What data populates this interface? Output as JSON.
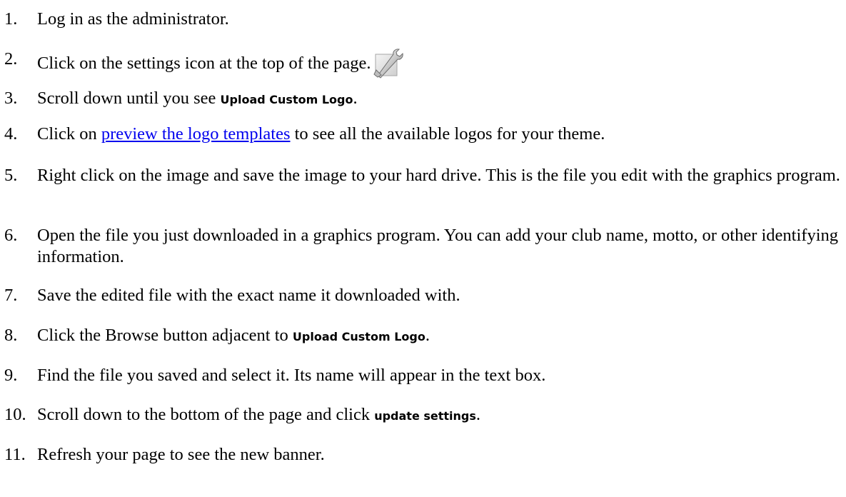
{
  "steps": [
    {
      "num": "1.",
      "text": "Log in as the administrator."
    },
    {
      "num": "2.",
      "text": "Click on the settings icon at the top of the page.",
      "icon": "wrench-settings-icon"
    },
    {
      "num": "3.",
      "pre": "Scroll down until you see ",
      "ui": "Upload Custom Logo",
      "post": "."
    },
    {
      "num": "4.",
      "pre": "Click on ",
      "link": "preview the logo templates",
      "post": " to see all the available logos for your theme."
    },
    {
      "num": "5.",
      "text": "Right click on the image and save the image to your hard drive. This is the file you edit with the graphics program."
    },
    {
      "num": "6.",
      "text": "Open the file you just downloaded in a graphics program. You can add your club name, motto, or other identifying information."
    },
    {
      "num": "7.",
      "text": "Save the edited file with the exact name it downloaded with."
    },
    {
      "num": "8.",
      "pre": "Click the Browse button adjacent to ",
      "ui": "Upload Custom Logo",
      "post": "."
    },
    {
      "num": "9.",
      "text": "Find the file you saved and select it. Its name will appear in the text box."
    },
    {
      "num": "10.",
      "pre": "Scroll down to the bottom of the page and click ",
      "ui": "update settings",
      "post": "."
    },
    {
      "num": "11.",
      "text": "Refresh your page to see the new banner."
    }
  ],
  "colors": {
    "link": "#0000ee",
    "text": "#000000",
    "background": "#ffffff"
  }
}
